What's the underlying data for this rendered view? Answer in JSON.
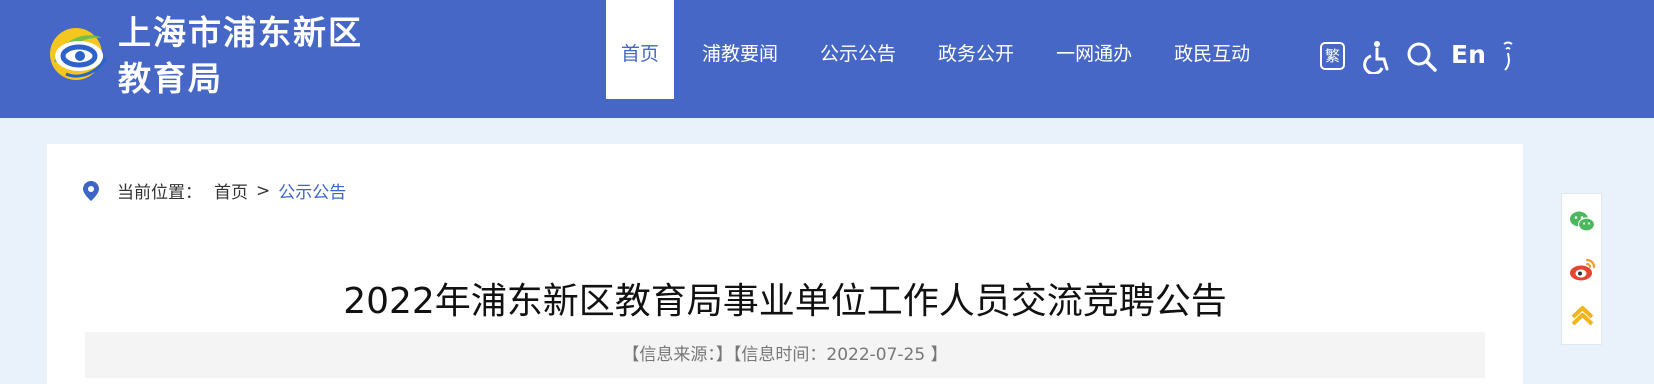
{
  "site": {
    "title_line1": "上海市浦东新区",
    "title_line2": "教育局"
  },
  "nav": {
    "items": [
      {
        "label": "首页"
      },
      {
        "label": "浦教要闻"
      },
      {
        "label": "公示公告"
      },
      {
        "label": "政务公开"
      },
      {
        "label": "一网通办"
      },
      {
        "label": "政民互动"
      }
    ]
  },
  "tools": {
    "traditional_label": "繁",
    "english_label": "En",
    "icons": [
      "traditional-chinese-icon",
      "accessibility-icon",
      "search-icon",
      "english-icon",
      "voice-icon"
    ]
  },
  "breadcrumb": {
    "prefix": "当前位置：",
    "home": "首页",
    "separator": ">",
    "current": "公示公告"
  },
  "article": {
    "title": "2022年浦东新区教育局事业单位工作人员交流竞聘公告",
    "meta": "【信息来源：】【信息时间：2022-07-25 】"
  },
  "share": {
    "icons": [
      "wechat-icon",
      "weibo-icon",
      "back-to-top-icon"
    ]
  },
  "colors": {
    "header_bg": "#4667c6",
    "page_bg": "#e9f1fa",
    "link": "#3c65c5",
    "wechat": "#4cb85e",
    "weibo": "#e6452f",
    "top": "#f3b41c"
  }
}
